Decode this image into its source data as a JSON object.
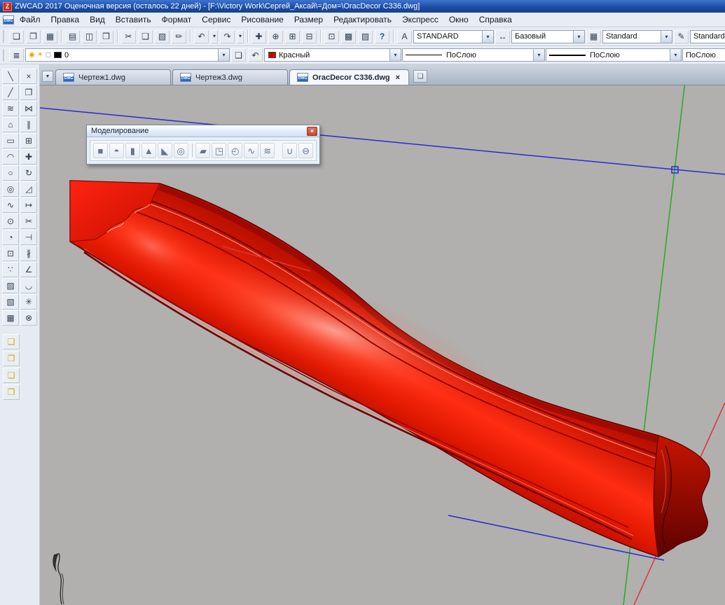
{
  "window": {
    "title": "ZWCAD 2017 Оценочная версия (осталось 22 дней) - [F:\\Victory Work\\Сергей_Аксай\\=Дом=\\OracDecor C336.dwg]",
    "logo_glyph": "Z"
  },
  "ui": {
    "combo_arrow": "▾"
  },
  "menu": {
    "items": [
      "Файл",
      "Правка",
      "Вид",
      "Вставить",
      "Формат",
      "Сервис",
      "Рисование",
      "Размер",
      "Редактировать",
      "Экспресс",
      "Окно",
      "Справка"
    ]
  },
  "tb1": [
    {
      "name": "new-file",
      "glyph": "❏"
    },
    {
      "name": "open-file",
      "glyph": "❐"
    },
    {
      "name": "save",
      "glyph": "▦"
    },
    {
      "name": "print",
      "glyph": "▤"
    },
    {
      "name": "print-preview",
      "glyph": "◫"
    },
    {
      "name": "publish",
      "glyph": "❒"
    },
    {
      "name": "cut",
      "glyph": "✂"
    },
    {
      "name": "copy",
      "glyph": "❑"
    },
    {
      "name": "paste",
      "glyph": "▧"
    },
    {
      "name": "match-properties",
      "glyph": "✏"
    },
    {
      "name": "undo",
      "glyph": "↶"
    },
    {
      "name": "redo",
      "glyph": "↷"
    },
    {
      "name": "pan",
      "glyph": "✚"
    },
    {
      "name": "zoom-realtime",
      "glyph": "⊕"
    },
    {
      "name": "zoom-window",
      "glyph": "⊞"
    },
    {
      "name": "zoom-previous",
      "glyph": "⊟"
    },
    {
      "name": "calculator",
      "glyph": "⊡"
    },
    {
      "name": "distance",
      "glyph": "▩"
    },
    {
      "name": "toolbars",
      "glyph": "▨"
    },
    {
      "name": "help",
      "glyph": "?"
    }
  ],
  "styles": {
    "text_icon": "A",
    "text_value": "STANDARD",
    "dim_icon": "↔",
    "dim_value": "Базовый",
    "table_icon": "▦",
    "table_value": "Standard",
    "mleader_icon": "✎",
    "mleader_value": "Standard"
  },
  "tb2": {
    "layer_props_glyph": "≣",
    "bulb_glyph": "◉",
    "sun_glyph": "☀",
    "lock_glyph": "◻",
    "layer_value": "0",
    "make_current_glyph": "❏",
    "layer_previous_glyph": "↶",
    "color_value": "Красный",
    "linetype_value": "ПоСлою",
    "lineweight_value": "ПоСлою",
    "plot_value": "ПоСлою"
  },
  "tabs": {
    "scroll_glyph": "▼",
    "close_glyph": "×",
    "new_glyph": "❏",
    "badge": "DWG",
    "items": [
      {
        "label": "Чертеж1.dwg"
      },
      {
        "label": "Чертеж3.dwg"
      },
      {
        "label": "OracDecor C336.dwg"
      }
    ]
  },
  "palette": {
    "col1": [
      {
        "name": "line",
        "glyph": "╲"
      },
      {
        "name": "ray",
        "glyph": "╱"
      },
      {
        "name": "polyline",
        "glyph": "≋"
      },
      {
        "name": "polygon",
        "glyph": "⌂"
      },
      {
        "name": "rectangle",
        "glyph": "▭"
      },
      {
        "name": "arc",
        "glyph": "◠"
      },
      {
        "name": "circle",
        "glyph": "○"
      },
      {
        "name": "donut",
        "glyph": "◎"
      },
      {
        "name": "spline",
        "glyph": "∿"
      },
      {
        "name": "ellipse",
        "glyph": "⊙"
      },
      {
        "name": "ellipse-arc",
        "glyph": "◔"
      },
      {
        "name": "insert-block",
        "glyph": "⊡"
      },
      {
        "name": "point",
        "glyph": "∵"
      },
      {
        "name": "hatch",
        "glyph": "▨"
      },
      {
        "name": "gradient",
        "glyph": "▧"
      },
      {
        "name": "region",
        "glyph": "▦"
      }
    ],
    "col2": [
      {
        "name": "erase",
        "glyph": "×"
      },
      {
        "name": "copy",
        "glyph": "❐"
      },
      {
        "name": "mirror",
        "glyph": "⋈"
      },
      {
        "name": "offset",
        "glyph": "∥"
      },
      {
        "name": "array",
        "glyph": "⊞"
      },
      {
        "name": "move",
        "glyph": "✚"
      },
      {
        "name": "rotate",
        "glyph": "↻"
      },
      {
        "name": "scale",
        "glyph": "◿"
      },
      {
        "name": "stretch",
        "glyph": "↦"
      },
      {
        "name": "trim",
        "glyph": "✂"
      },
      {
        "name": "extend",
        "glyph": "⊣"
      },
      {
        "name": "break",
        "glyph": "∦"
      },
      {
        "name": "chamfer",
        "glyph": "∠"
      },
      {
        "name": "fillet",
        "glyph": "◡"
      },
      {
        "name": "explode",
        "glyph": "✳"
      },
      {
        "name": "join",
        "glyph": "⊗"
      }
    ],
    "extra": [
      {
        "name": "layer-tool-1",
        "glyph": "❏"
      },
      {
        "name": "layer-tool-2",
        "glyph": "❐"
      },
      {
        "name": "layer-tool-3",
        "glyph": "❑"
      },
      {
        "name": "layer-tool-4",
        "glyph": "❒"
      }
    ]
  },
  "modeling": {
    "title": "Моделирование",
    "close_glyph": "×",
    "icons": [
      {
        "name": "box",
        "glyph": "■"
      },
      {
        "name": "sphere",
        "glyph": "◓"
      },
      {
        "name": "cylinder",
        "glyph": "▮"
      },
      {
        "name": "cone",
        "glyph": "▲"
      },
      {
        "name": "wedge",
        "glyph": "◣"
      },
      {
        "name": "torus",
        "glyph": "◎"
      },
      {
        "name": "polysolid",
        "glyph": "▰"
      },
      {
        "name": "extrude",
        "glyph": "◳"
      },
      {
        "name": "revolve",
        "glyph": "◴"
      },
      {
        "name": "sweep",
        "glyph": "∿"
      },
      {
        "name": "loft",
        "glyph": "≋"
      },
      {
        "name": "union",
        "glyph": "∪"
      },
      {
        "name": "subtract",
        "glyph": "⊖"
      }
    ]
  },
  "colors": {
    "model_red": "#e01000",
    "axis_blue": "#2a2ad0",
    "axis_green": "#1fae1f",
    "axis_red": "#e03434",
    "canvas_bg": "#b1b0ae",
    "current_color": "#d00000",
    "layer_chip": "#000000"
  }
}
